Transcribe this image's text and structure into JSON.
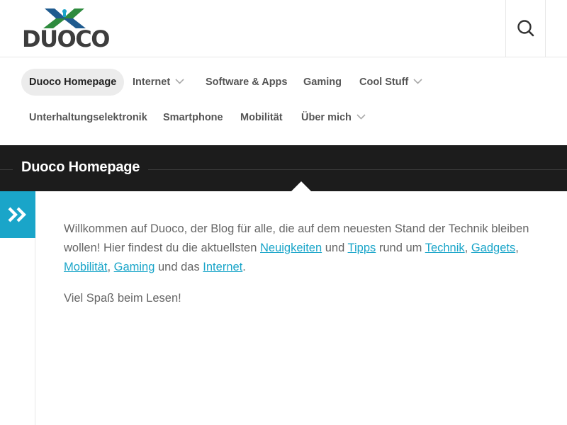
{
  "brand": {
    "name": "DUOCO",
    "colors": {
      "green": "#2e8b3e",
      "blue": "#1f5b8f",
      "accent": "#1aa5c9",
      "dark": "#1c1c1c"
    }
  },
  "header": {
    "search_icon": "search-icon"
  },
  "nav": {
    "row1": [
      {
        "label": "Duoco Homepage",
        "active": true,
        "dropdown": false
      },
      {
        "label": "Internet",
        "dropdown": true
      },
      {
        "label": "Software & Apps",
        "dropdown": false
      },
      {
        "label": "Gaming",
        "dropdown": false
      },
      {
        "label": "Cool Stuff",
        "dropdown": true
      }
    ],
    "row2": [
      {
        "label": "Unterhaltungselektronik",
        "dropdown": false
      },
      {
        "label": "Smartphone",
        "dropdown": false
      },
      {
        "label": "Mobilität",
        "dropdown": false
      },
      {
        "label": "Über mich",
        "dropdown": true
      }
    ]
  },
  "page": {
    "title": "Duoco Homepage",
    "sidebar_toggle_icon": "double-chevron-right-icon"
  },
  "content": {
    "p1": {
      "t1": "Willkommen auf Duoco, der Blog für alle, die auf dem neuesten Stand der Technik bleiben wollen! Hier findest du die aktuellsten ",
      "link_neuigkeiten": "Neuigkeiten",
      "t2": " und ",
      "link_tipps": "Tipps",
      "t3": " rund um ",
      "link_technik": "Technik",
      "t4": ", ",
      "link_gadgets": "Gadgets",
      "t5": ", ",
      "link_mobilitaet": "Mobilität",
      "t6": ", ",
      "link_gaming": "Gaming",
      "t7": " und das ",
      "link_internet": "Internet",
      "t8": "."
    },
    "p2": "Viel Spaß beim Lesen!"
  }
}
